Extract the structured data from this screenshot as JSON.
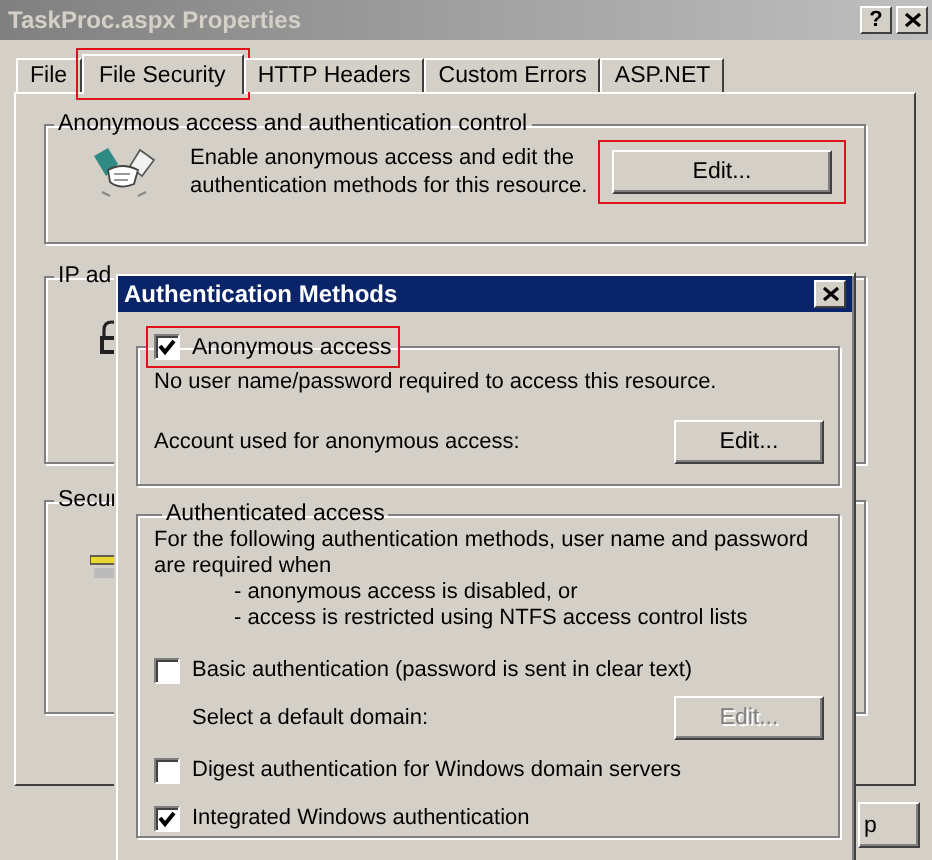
{
  "window": {
    "title": "TaskProc.aspx Properties",
    "help_button": "?"
  },
  "tabs": [
    {
      "label": "File",
      "selected": false,
      "highlighted": false
    },
    {
      "label": "File Security",
      "selected": true,
      "highlighted": true
    },
    {
      "label": "HTTP Headers",
      "selected": false,
      "highlighted": false
    },
    {
      "label": "Custom Errors",
      "selected": false,
      "highlighted": false
    },
    {
      "label": "ASP.NET",
      "selected": false,
      "highlighted": false
    }
  ],
  "anonymous_group": {
    "legend": "Anonymous access and authentication control",
    "description": "Enable anonymous access and edit the authentication methods for this resource.",
    "button": {
      "label": "Edit...",
      "highlighted": true
    }
  },
  "ip_group": {
    "legend": "IP ad"
  },
  "secure_group": {
    "legend": "Secur"
  },
  "footer_button": {
    "label": "p"
  },
  "dialog": {
    "title": "Authentication Methods",
    "anonymous": {
      "label": "Anonymous access",
      "checked": true,
      "highlighted": true,
      "description": "No user name/password required to access this resource.",
      "account_label": "Account used for anonymous access:",
      "button": {
        "label": "Edit...",
        "disabled": false
      }
    },
    "authenticated": {
      "legend": "Authenticated access",
      "intro": "For the following authentication methods, user name and password are required when",
      "conditions": [
        "- anonymous access is disabled, or",
        "- access is restricted using NTFS access control lists"
      ],
      "options": [
        {
          "kind": "checkbox",
          "label": "Basic authentication (password is sent in clear text)",
          "checked": false
        },
        {
          "kind": "domain",
          "label": "Select a default domain:",
          "button": {
            "label": "Edit...",
            "disabled": true
          }
        },
        {
          "kind": "checkbox",
          "label": "Digest authentication for Windows domain servers",
          "checked": false
        },
        {
          "kind": "checkbox",
          "label": "Integrated Windows authentication",
          "checked": true
        }
      ]
    }
  }
}
